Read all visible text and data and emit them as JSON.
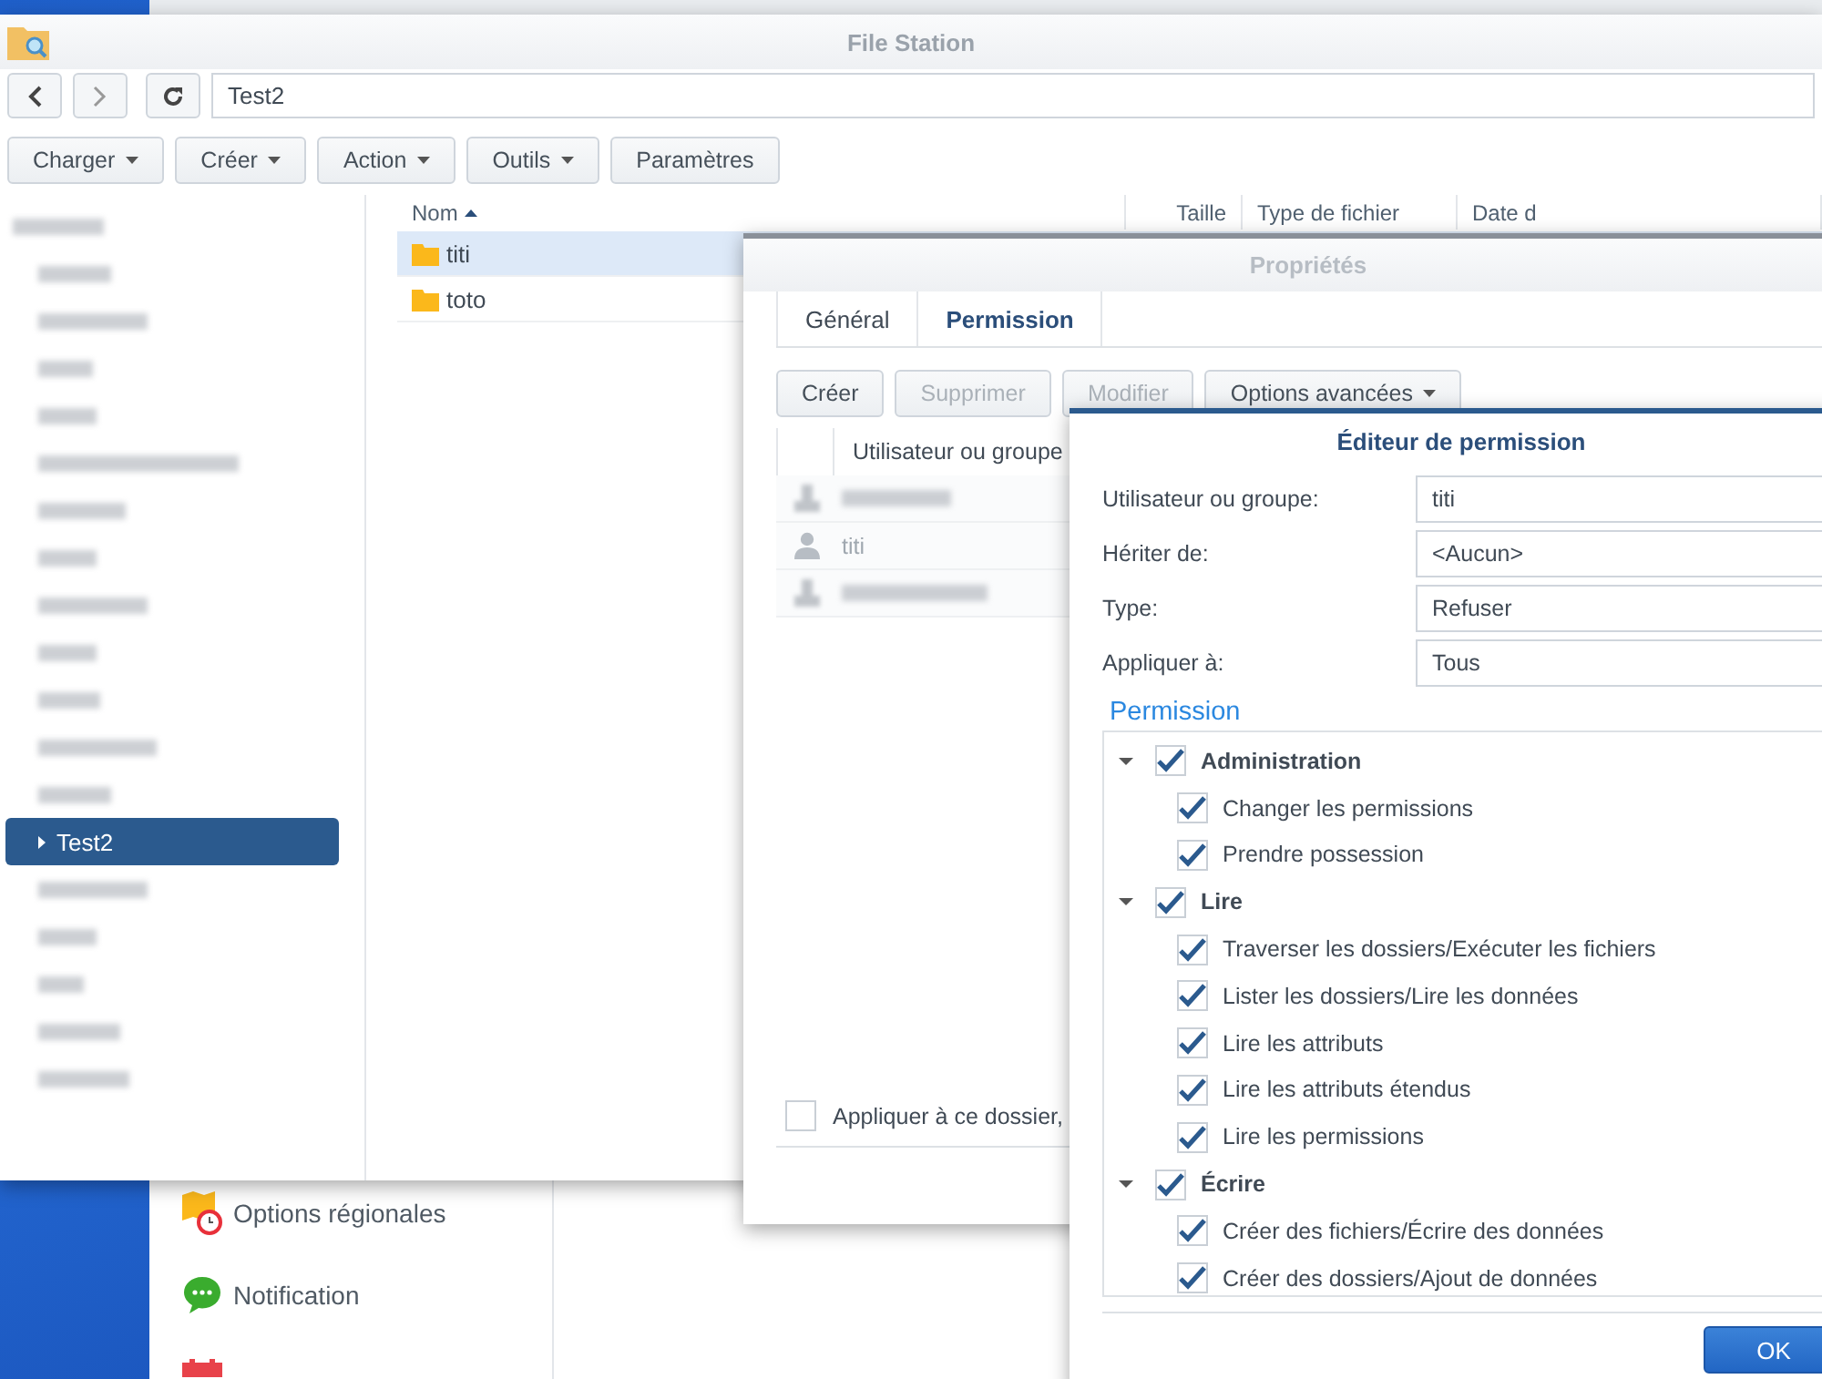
{
  "control_panel": {
    "items": [
      {
        "label": "Options régionales",
        "kind": "region"
      },
      {
        "label": "Notification",
        "kind": "notification"
      },
      {
        "kind": "calendar"
      }
    ]
  },
  "file_station": {
    "title": "File Station",
    "path": "Test2",
    "toolbar": [
      {
        "label": "Charger",
        "menu": true
      },
      {
        "label": "Créer",
        "menu": true
      },
      {
        "label": "Action",
        "menu": true
      },
      {
        "label": "Outils",
        "menu": true
      },
      {
        "label": "Paramètres",
        "menu": false
      }
    ],
    "tree": {
      "kind": "blurred",
      "selected": false,
      "children": [
        {
          "kind": "blurred",
          "selected": false
        },
        {
          "kind": "blurred",
          "selected": false
        },
        {
          "kind": "blurred",
          "selected": false
        },
        {
          "kind": "blurred",
          "selected": false
        },
        {
          "kind": "blurred",
          "selected": false
        },
        {
          "kind": "blurred",
          "selected": false
        },
        {
          "kind": "blurred",
          "selected": false
        },
        {
          "kind": "blurred",
          "selected": false
        },
        {
          "kind": "blurred",
          "selected": false
        },
        {
          "kind": "blurred",
          "selected": false
        },
        {
          "kind": "blurred",
          "selected": false
        },
        {
          "kind": "blurred",
          "selected": false
        },
        {
          "kind": "folder",
          "label": "Test2",
          "selected": true
        },
        {
          "kind": "blurred",
          "selected": false
        },
        {
          "kind": "blurred",
          "selected": false
        },
        {
          "kind": "blurred",
          "selected": false
        },
        {
          "kind": "blurred",
          "selected": false
        },
        {
          "kind": "blurred",
          "selected": false
        }
      ]
    },
    "columns": [
      {
        "label": "Nom",
        "sorted": true
      },
      {
        "label": "Taille",
        "sorted": false
      },
      {
        "label": "Type de fichier",
        "sorted": false
      },
      {
        "label": "Date d",
        "sorted": false
      }
    ],
    "files": [
      {
        "name": "titi",
        "selected": true
      },
      {
        "name": "toto",
        "selected": false
      }
    ]
  },
  "properties": {
    "title": "Propriétés",
    "tabs": [
      {
        "label": "Général",
        "selected": false
      },
      {
        "label": "Permission",
        "selected": true
      }
    ],
    "buttons": [
      {
        "label": "Créer",
        "disabled": false,
        "menu": false
      },
      {
        "label": "Supprimer",
        "disabled": true,
        "menu": false
      },
      {
        "label": "Modifier",
        "disabled": true,
        "menu": false
      },
      {
        "label": "Options avancées",
        "disabled": false,
        "menu": true
      }
    ],
    "column": "Utilisateur ou groupe",
    "users": [
      {
        "kind": "blurred"
      },
      {
        "kind": "user",
        "name": "titi"
      },
      {
        "kind": "blurred"
      }
    ],
    "apply": {
      "label": "Appliquer à ce dossier,",
      "checked": false
    }
  },
  "editor": {
    "title": "Éditeur de permission",
    "fields": [
      {
        "label": "Utilisateur ou groupe:",
        "value": "titi"
      },
      {
        "label": "Hériter de:",
        "value": "<Aucun>"
      },
      {
        "label": "Type:",
        "value": "Refuser"
      },
      {
        "label": "Appliquer à:",
        "value": "Tous"
      }
    ],
    "section": "Permission",
    "permissions": [
      {
        "label": "Administration",
        "checked": true,
        "expanded": true,
        "children": [
          {
            "label": "Changer les permissions",
            "checked": true
          },
          {
            "label": "Prendre possession",
            "checked": true
          }
        ]
      },
      {
        "label": "Lire",
        "checked": true,
        "expanded": true,
        "children": [
          {
            "label": "Traverser les dossiers/Exécuter les fichiers",
            "checked": true
          },
          {
            "label": "Lister les dossiers/Lire les données",
            "checked": true
          },
          {
            "label": "Lire les attributs",
            "checked": true
          },
          {
            "label": "Lire les attributs étendus",
            "checked": true
          },
          {
            "label": "Lire les permissions",
            "checked": true
          }
        ]
      },
      {
        "label": "Écrire",
        "checked": true,
        "expanded": true,
        "children": [
          {
            "label": "Créer des fichiers/Écrire des données",
            "checked": true
          },
          {
            "label": "Créer des dossiers/Ajout de données",
            "checked": true
          }
        ]
      }
    ],
    "ok": "OK"
  }
}
